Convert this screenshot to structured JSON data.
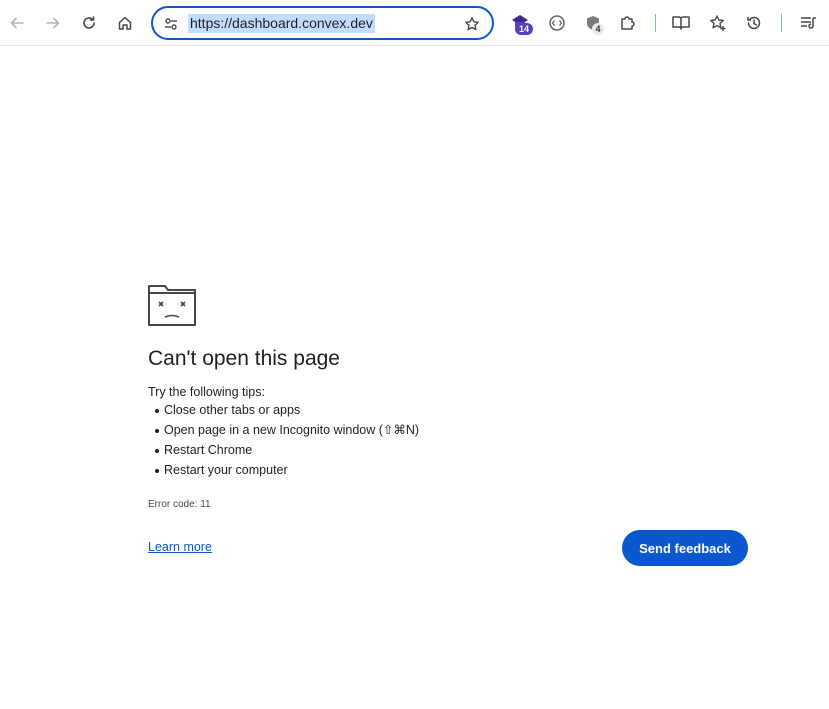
{
  "browser": {
    "url": "https://dashboard.convex.dev",
    "icons": [
      "back-icon",
      "forward-icon",
      "reload-icon",
      "home-icon",
      "site-info-icon",
      "bookmark-star-icon",
      "graduation-extension-icon",
      "code-extension-icon",
      "shield-extension-icon",
      "extensions-puzzle-icon",
      "reading-mode-icon",
      "favorites-icon",
      "history-icon",
      "reading-list-icon"
    ],
    "badges": {
      "graduation": "14",
      "shield": "4"
    },
    "accent": "#0b57d0",
    "badge_purple": "#5b3cc4"
  },
  "error_page": {
    "title": "Can't open this page",
    "tips_intro": "Try the following tips:",
    "tips": [
      "Close other tabs or apps",
      "Open page in a new Incognito window (⇧⌘N)",
      "Restart Chrome",
      "Restart your computer"
    ],
    "error_code": "Error code: 11",
    "learn_more": "Learn more",
    "send_feedback": "Send feedback",
    "icon": "sad-folder-icon"
  }
}
